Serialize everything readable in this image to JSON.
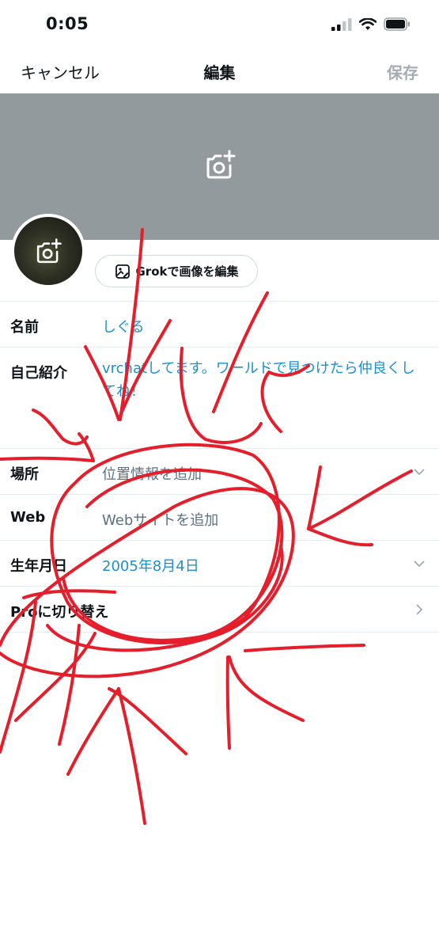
{
  "status": {
    "time": "0:05"
  },
  "nav": {
    "cancel": "キャンセル",
    "title": "編集",
    "save": "保存"
  },
  "grok_button": {
    "label": "Grokで画像を編集"
  },
  "fields": {
    "name": {
      "label": "名前",
      "value": "しぐる"
    },
    "bio": {
      "label": "自己紹介",
      "value": "vrchatしてます。ワールドで見つけたら仲良くしてね！"
    },
    "location": {
      "label": "場所",
      "placeholder": "位置情報を追加"
    },
    "web": {
      "label": "Web",
      "placeholder": "Webサイトを追加"
    },
    "birthday": {
      "label": "生年月日",
      "value": "2005年8月4日"
    },
    "pro": {
      "label": "Proに切り替え"
    }
  },
  "colors": {
    "accent": "#1d8fcf",
    "banner": "#939a9e",
    "annotation": "#e41e2b"
  }
}
